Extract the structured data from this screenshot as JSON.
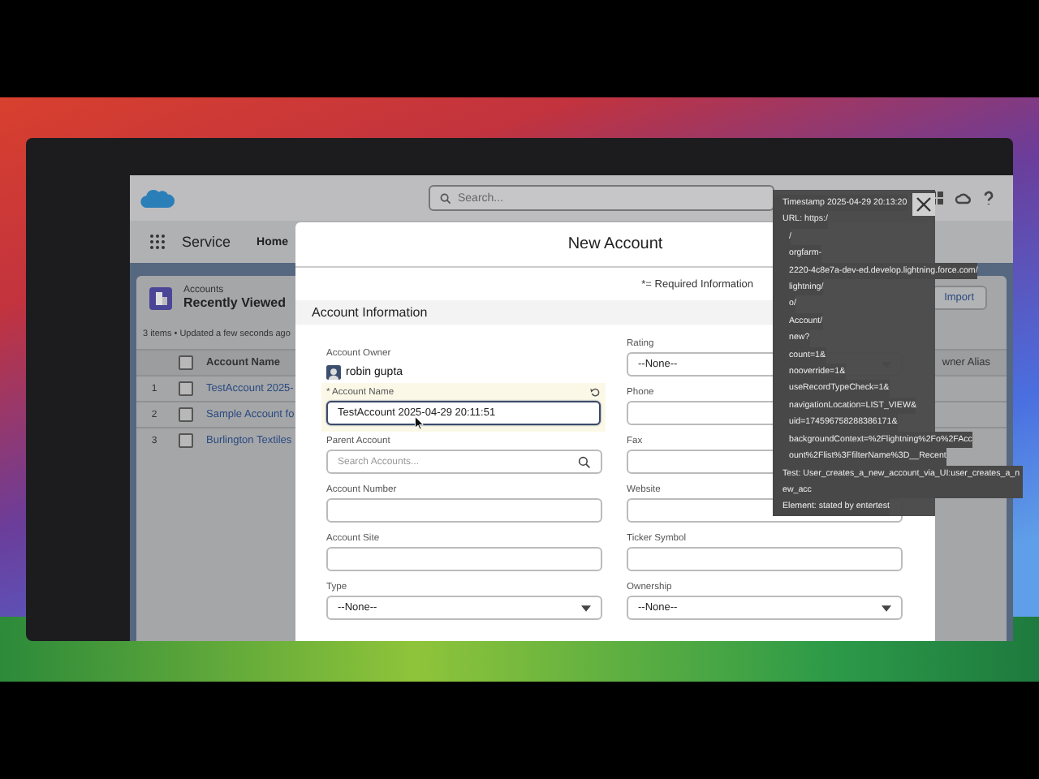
{
  "app": {
    "name": "Service",
    "nav": [
      "Home"
    ],
    "search_placeholder": "Search..."
  },
  "list": {
    "object": "Accounts",
    "title": "Recently Viewed",
    "status": "3 items • Updated a few seconds ago",
    "buttons": [
      "Import"
    ],
    "select_all_checked": false,
    "columns": [
      "Account Name",
      "wner Alias"
    ],
    "rows": [
      {
        "num": "1",
        "name": "TestAccount 2025-",
        "checked": false
      },
      {
        "num": "2",
        "name": "Sample Account fo",
        "checked": false
      },
      {
        "num": "3",
        "name": "Burlington Textiles",
        "checked": false
      }
    ]
  },
  "modal": {
    "title": "New Account",
    "required_note": "*= Required Information",
    "section": "Account Information",
    "owner": {
      "label": "Account Owner",
      "value": "robin gupta"
    },
    "left_fields": [
      {
        "label": "* Account Name",
        "kind": "text",
        "value": "TestAccount 2025-04-29 20:11:51",
        "edited": true,
        "focused": true
      },
      {
        "label": "Parent Account",
        "kind": "lookup",
        "placeholder": "Search Accounts...",
        "edited": false,
        "focused": false
      },
      {
        "label": "Account Number",
        "kind": "text",
        "edited": false,
        "focused": false
      },
      {
        "label": "Account Site",
        "kind": "text",
        "edited": false,
        "focused": false
      },
      {
        "label": "Type",
        "kind": "select",
        "value": "--None--",
        "edited": false,
        "focused": false
      }
    ],
    "right_fields": [
      {
        "label": "Rating",
        "kind": "select",
        "value": "--None--",
        "edited": false,
        "focused": false
      },
      {
        "label": "Phone",
        "kind": "text",
        "edited": false,
        "focused": false
      },
      {
        "label": "Fax",
        "kind": "text",
        "edited": false,
        "focused": false
      },
      {
        "label": "Website",
        "kind": "text",
        "edited": false,
        "focused": false
      },
      {
        "label": "Ticker Symbol",
        "kind": "text",
        "edited": false,
        "focused": false
      },
      {
        "label": "Ownership",
        "kind": "select",
        "value": "--None--",
        "edited": false,
        "focused": false
      }
    ]
  },
  "tooltip": {
    "lines": [
      "Timestamp 2025-04-29 20:13:20",
      "URL: https:/",
      "/",
      "orgfarm-",
      "2220-4c8e7a-dev-ed.develop.lightning.force.com/",
      "lightning/",
      "o/",
      "Account/",
      "new?",
      "count=1&",
      "nooverride=1&",
      "useRecordTypeCheck=1&",
      "navigationLocation=LIST_VIEW&",
      "uid=174596758288386171&",
      "backgroundContext=%2Flightning%2Fo%2FAcc",
      "ount%2Flist%3FfilterName%3D__Recent",
      "Test: User_creates_a_new_account_via_UI:user_creates_a_new_acc",
      "Element: stated by entertest"
    ]
  }
}
